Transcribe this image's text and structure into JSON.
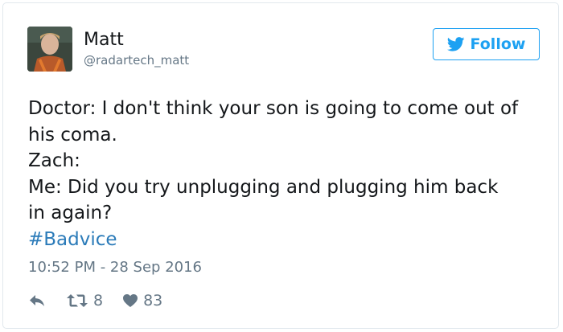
{
  "user": {
    "name": "Matt",
    "handle": "@radartech_matt"
  },
  "follow_button": {
    "label": "Follow",
    "icon": "twitter-bird-icon",
    "color": "#1da1f2"
  },
  "tweet": {
    "lines": [
      "Doctor: I don't think your son is going to come out of",
      "his coma.",
      "Zach:",
      "Me: Did you try unplugging and plugging him back",
      "in again?"
    ],
    "hashtag": "#Badvice",
    "hashtag_color": "#2b7bb9",
    "timestamp": "10:52 PM - 28 Sep 2016"
  },
  "actions": {
    "reply_icon": "reply-icon",
    "retweet_icon": "retweet-icon",
    "retweet_count": "8",
    "like_icon": "heart-icon",
    "like_count": "83"
  }
}
